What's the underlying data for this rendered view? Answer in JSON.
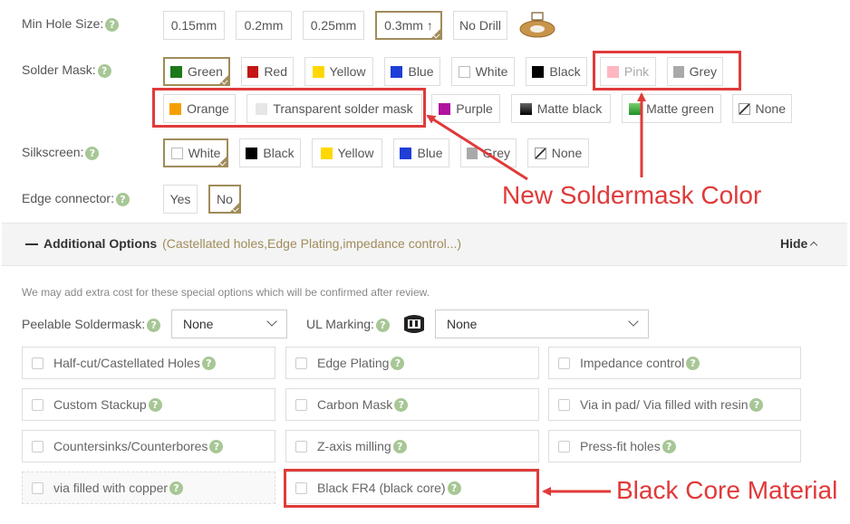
{
  "min_hole": {
    "label": "Min Hole Size:",
    "options": [
      "0.15mm",
      "0.2mm",
      "0.25mm",
      "0.3mm ↑",
      "No Drill"
    ],
    "selected": "0.3mm ↑"
  },
  "solder_mask": {
    "label": "Solder Mask:",
    "row1": [
      {
        "label": "Green",
        "color": "#1a7a1a"
      },
      {
        "label": "Red",
        "color": "#c41717"
      },
      {
        "label": "Yellow",
        "color": "#ffd800"
      },
      {
        "label": "Blue",
        "color": "#1f3fd6"
      },
      {
        "label": "White",
        "color": "#ffffff"
      },
      {
        "label": "Black",
        "color": "#000000"
      },
      {
        "label": "Pink",
        "color": "#ffb6c1"
      },
      {
        "label": "Grey",
        "color": "#a9a9a9"
      }
    ],
    "row2": [
      {
        "label": "Orange",
        "color": "#f5a000"
      },
      {
        "label": "Transparent solder mask",
        "color": "#e6e6e6"
      },
      {
        "label": "Purple",
        "color": "#b0139e"
      },
      {
        "label": "Matte black",
        "color": "#000000"
      },
      {
        "label": "Matte green",
        "color": "#2a9e33"
      },
      {
        "label": "None",
        "color": "none"
      }
    ],
    "selected": "Green"
  },
  "silkscreen": {
    "label": "Silkscreen:",
    "options": [
      {
        "label": "White",
        "color": "#ffffff"
      },
      {
        "label": "Black",
        "color": "#000000"
      },
      {
        "label": "Yellow",
        "color": "#ffd800"
      },
      {
        "label": "Blue",
        "color": "#1f3fd6"
      },
      {
        "label": "Grey",
        "color": "#a9a9a9"
      },
      {
        "label": "None",
        "color": "none"
      }
    ],
    "selected": "White"
  },
  "edge_connector": {
    "label": "Edge connector:",
    "options": [
      "Yes",
      "No"
    ],
    "selected": "No"
  },
  "additional": {
    "title": "Additional Options",
    "subtitle": "(Castellated holes,Edge Plating,impedance control...)",
    "hide_label": "Hide",
    "note": "We may add extra cost for these special options which will be confirmed after review.",
    "peelable_label": "Peelable Soldermask:",
    "peelable_value": "None",
    "ul_label": "UL Marking:",
    "ul_value": "None",
    "checkboxes": [
      "Half-cut/Castellated Holes",
      "Edge Plating",
      "Impedance control",
      "Custom Stackup",
      "Carbon Mask",
      "Via in pad/ Via filled with resin",
      "Countersinks/Counterbores",
      "Z-axis milling",
      "Press-fit holes",
      "via filled with copper",
      "Black FR4 (black core)"
    ]
  },
  "annotations": {
    "new_color": "New Soldermask Color",
    "black_core": "Black Core Material"
  },
  "help_glyph": "?",
  "accent_color": "#a08c5b",
  "annotation_color": "#e03a3a"
}
